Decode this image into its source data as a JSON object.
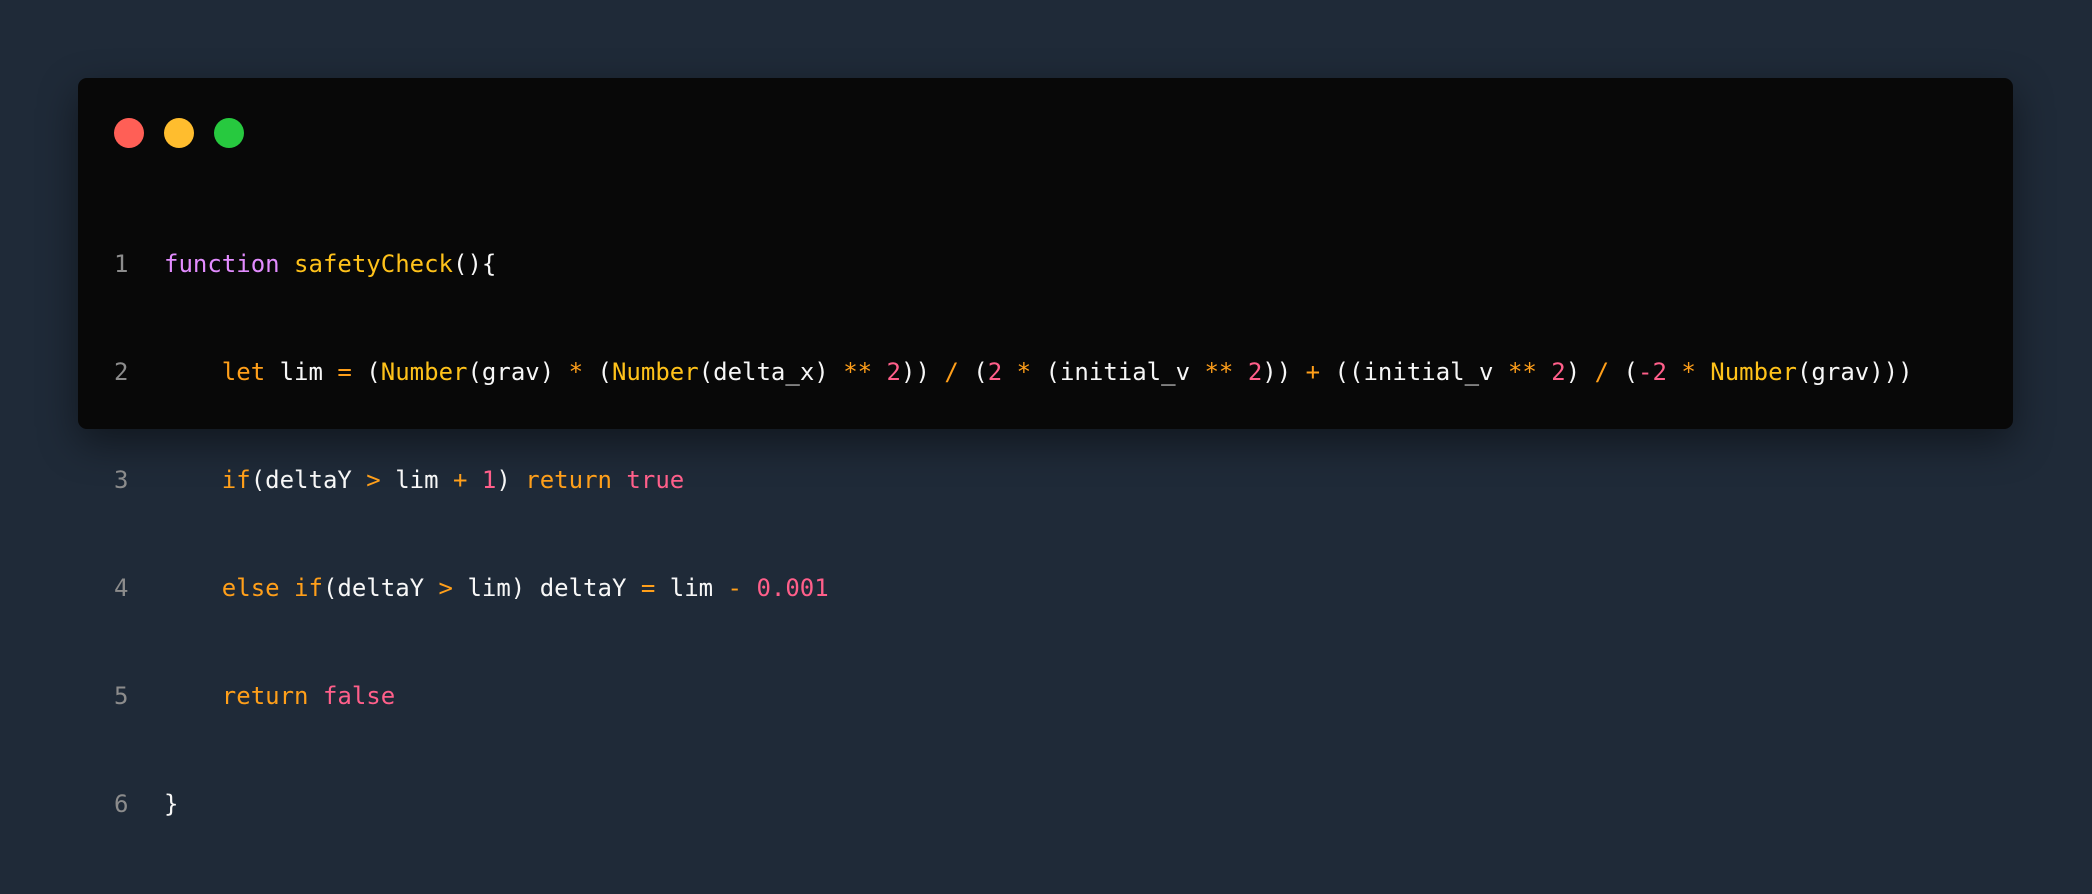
{
  "window": {
    "traffic_lights": [
      {
        "name": "close",
        "color": "#ff5f56"
      },
      {
        "name": "minimize",
        "color": "#ffbd2e"
      },
      {
        "name": "maximize",
        "color": "#27c93f"
      }
    ]
  },
  "code": {
    "lines": [
      {
        "number": "1",
        "tokens": [
          {
            "text": "function",
            "color": "#e38cff"
          },
          {
            "text": " ",
            "color": "#f7f7f7"
          },
          {
            "text": "safetyCheck",
            "color": "#ffc21a"
          },
          {
            "text": "(){",
            "color": "#f7f7f7"
          }
        ]
      },
      {
        "number": "2",
        "tokens": [
          {
            "text": "    ",
            "color": "#f7f7f7"
          },
          {
            "text": "let",
            "color": "#ff9f1a"
          },
          {
            "text": " lim ",
            "color": "#f7f7f7"
          },
          {
            "text": "=",
            "color": "#ff9f1a"
          },
          {
            "text": " (",
            "color": "#f7f7f7"
          },
          {
            "text": "Number",
            "color": "#ffc21a"
          },
          {
            "text": "(grav) ",
            "color": "#f7f7f7"
          },
          {
            "text": "*",
            "color": "#ff9f1a"
          },
          {
            "text": " (",
            "color": "#f7f7f7"
          },
          {
            "text": "Number",
            "color": "#ffc21a"
          },
          {
            "text": "(delta_x) ",
            "color": "#f7f7f7"
          },
          {
            "text": "**",
            "color": "#ff9f1a"
          },
          {
            "text": " ",
            "color": "#f7f7f7"
          },
          {
            "text": "2",
            "color": "#ff5f8a"
          },
          {
            "text": ")) ",
            "color": "#f7f7f7"
          },
          {
            "text": "/",
            "color": "#ff9f1a"
          },
          {
            "text": " (",
            "color": "#f7f7f7"
          },
          {
            "text": "2",
            "color": "#ff5f8a"
          },
          {
            "text": " ",
            "color": "#f7f7f7"
          },
          {
            "text": "*",
            "color": "#ff9f1a"
          },
          {
            "text": " (initial_v ",
            "color": "#f7f7f7"
          },
          {
            "text": "**",
            "color": "#ff9f1a"
          },
          {
            "text": " ",
            "color": "#f7f7f7"
          },
          {
            "text": "2",
            "color": "#ff5f8a"
          },
          {
            "text": ")) ",
            "color": "#f7f7f7"
          },
          {
            "text": "+",
            "color": "#ff9f1a"
          },
          {
            "text": " ((initial_v ",
            "color": "#f7f7f7"
          },
          {
            "text": "**",
            "color": "#ff9f1a"
          },
          {
            "text": " ",
            "color": "#f7f7f7"
          },
          {
            "text": "2",
            "color": "#ff5f8a"
          },
          {
            "text": ") ",
            "color": "#f7f7f7"
          },
          {
            "text": "/",
            "color": "#ff9f1a"
          },
          {
            "text": " (",
            "color": "#f7f7f7"
          },
          {
            "text": "-2",
            "color": "#ff5f8a"
          },
          {
            "text": " ",
            "color": "#f7f7f7"
          },
          {
            "text": "*",
            "color": "#ff9f1a"
          },
          {
            "text": " ",
            "color": "#f7f7f7"
          },
          {
            "text": "Number",
            "color": "#ffc21a"
          },
          {
            "text": "(grav)))",
            "color": "#f7f7f7"
          }
        ]
      },
      {
        "number": "3",
        "tokens": [
          {
            "text": "    ",
            "color": "#f7f7f7"
          },
          {
            "text": "if",
            "color": "#ff9f1a"
          },
          {
            "text": "(deltaY ",
            "color": "#f7f7f7"
          },
          {
            "text": ">",
            "color": "#ff9f1a"
          },
          {
            "text": " lim ",
            "color": "#f7f7f7"
          },
          {
            "text": "+",
            "color": "#ff9f1a"
          },
          {
            "text": " ",
            "color": "#f7f7f7"
          },
          {
            "text": "1",
            "color": "#ff5f8a"
          },
          {
            "text": ") ",
            "color": "#f7f7f7"
          },
          {
            "text": "return",
            "color": "#ff9f1a"
          },
          {
            "text": " ",
            "color": "#f7f7f7"
          },
          {
            "text": "true",
            "color": "#ff5f8a"
          }
        ]
      },
      {
        "number": "4",
        "tokens": [
          {
            "text": "    ",
            "color": "#f7f7f7"
          },
          {
            "text": "else",
            "color": "#ff9f1a"
          },
          {
            "text": " ",
            "color": "#f7f7f7"
          },
          {
            "text": "if",
            "color": "#ff9f1a"
          },
          {
            "text": "(deltaY ",
            "color": "#f7f7f7"
          },
          {
            "text": ">",
            "color": "#ff9f1a"
          },
          {
            "text": " lim) deltaY ",
            "color": "#f7f7f7"
          },
          {
            "text": "=",
            "color": "#ff9f1a"
          },
          {
            "text": " lim ",
            "color": "#f7f7f7"
          },
          {
            "text": "-",
            "color": "#ff9f1a"
          },
          {
            "text": " ",
            "color": "#f7f7f7"
          },
          {
            "text": "0.001",
            "color": "#ff5f8a"
          }
        ]
      },
      {
        "number": "5",
        "tokens": [
          {
            "text": "    ",
            "color": "#f7f7f7"
          },
          {
            "text": "return",
            "color": "#ff9f1a"
          },
          {
            "text": " ",
            "color": "#f7f7f7"
          },
          {
            "text": "false",
            "color": "#ff5f8a"
          }
        ]
      },
      {
        "number": "6",
        "tokens": [
          {
            "text": "}",
            "color": "#f7f7f7"
          }
        ]
      }
    ]
  }
}
